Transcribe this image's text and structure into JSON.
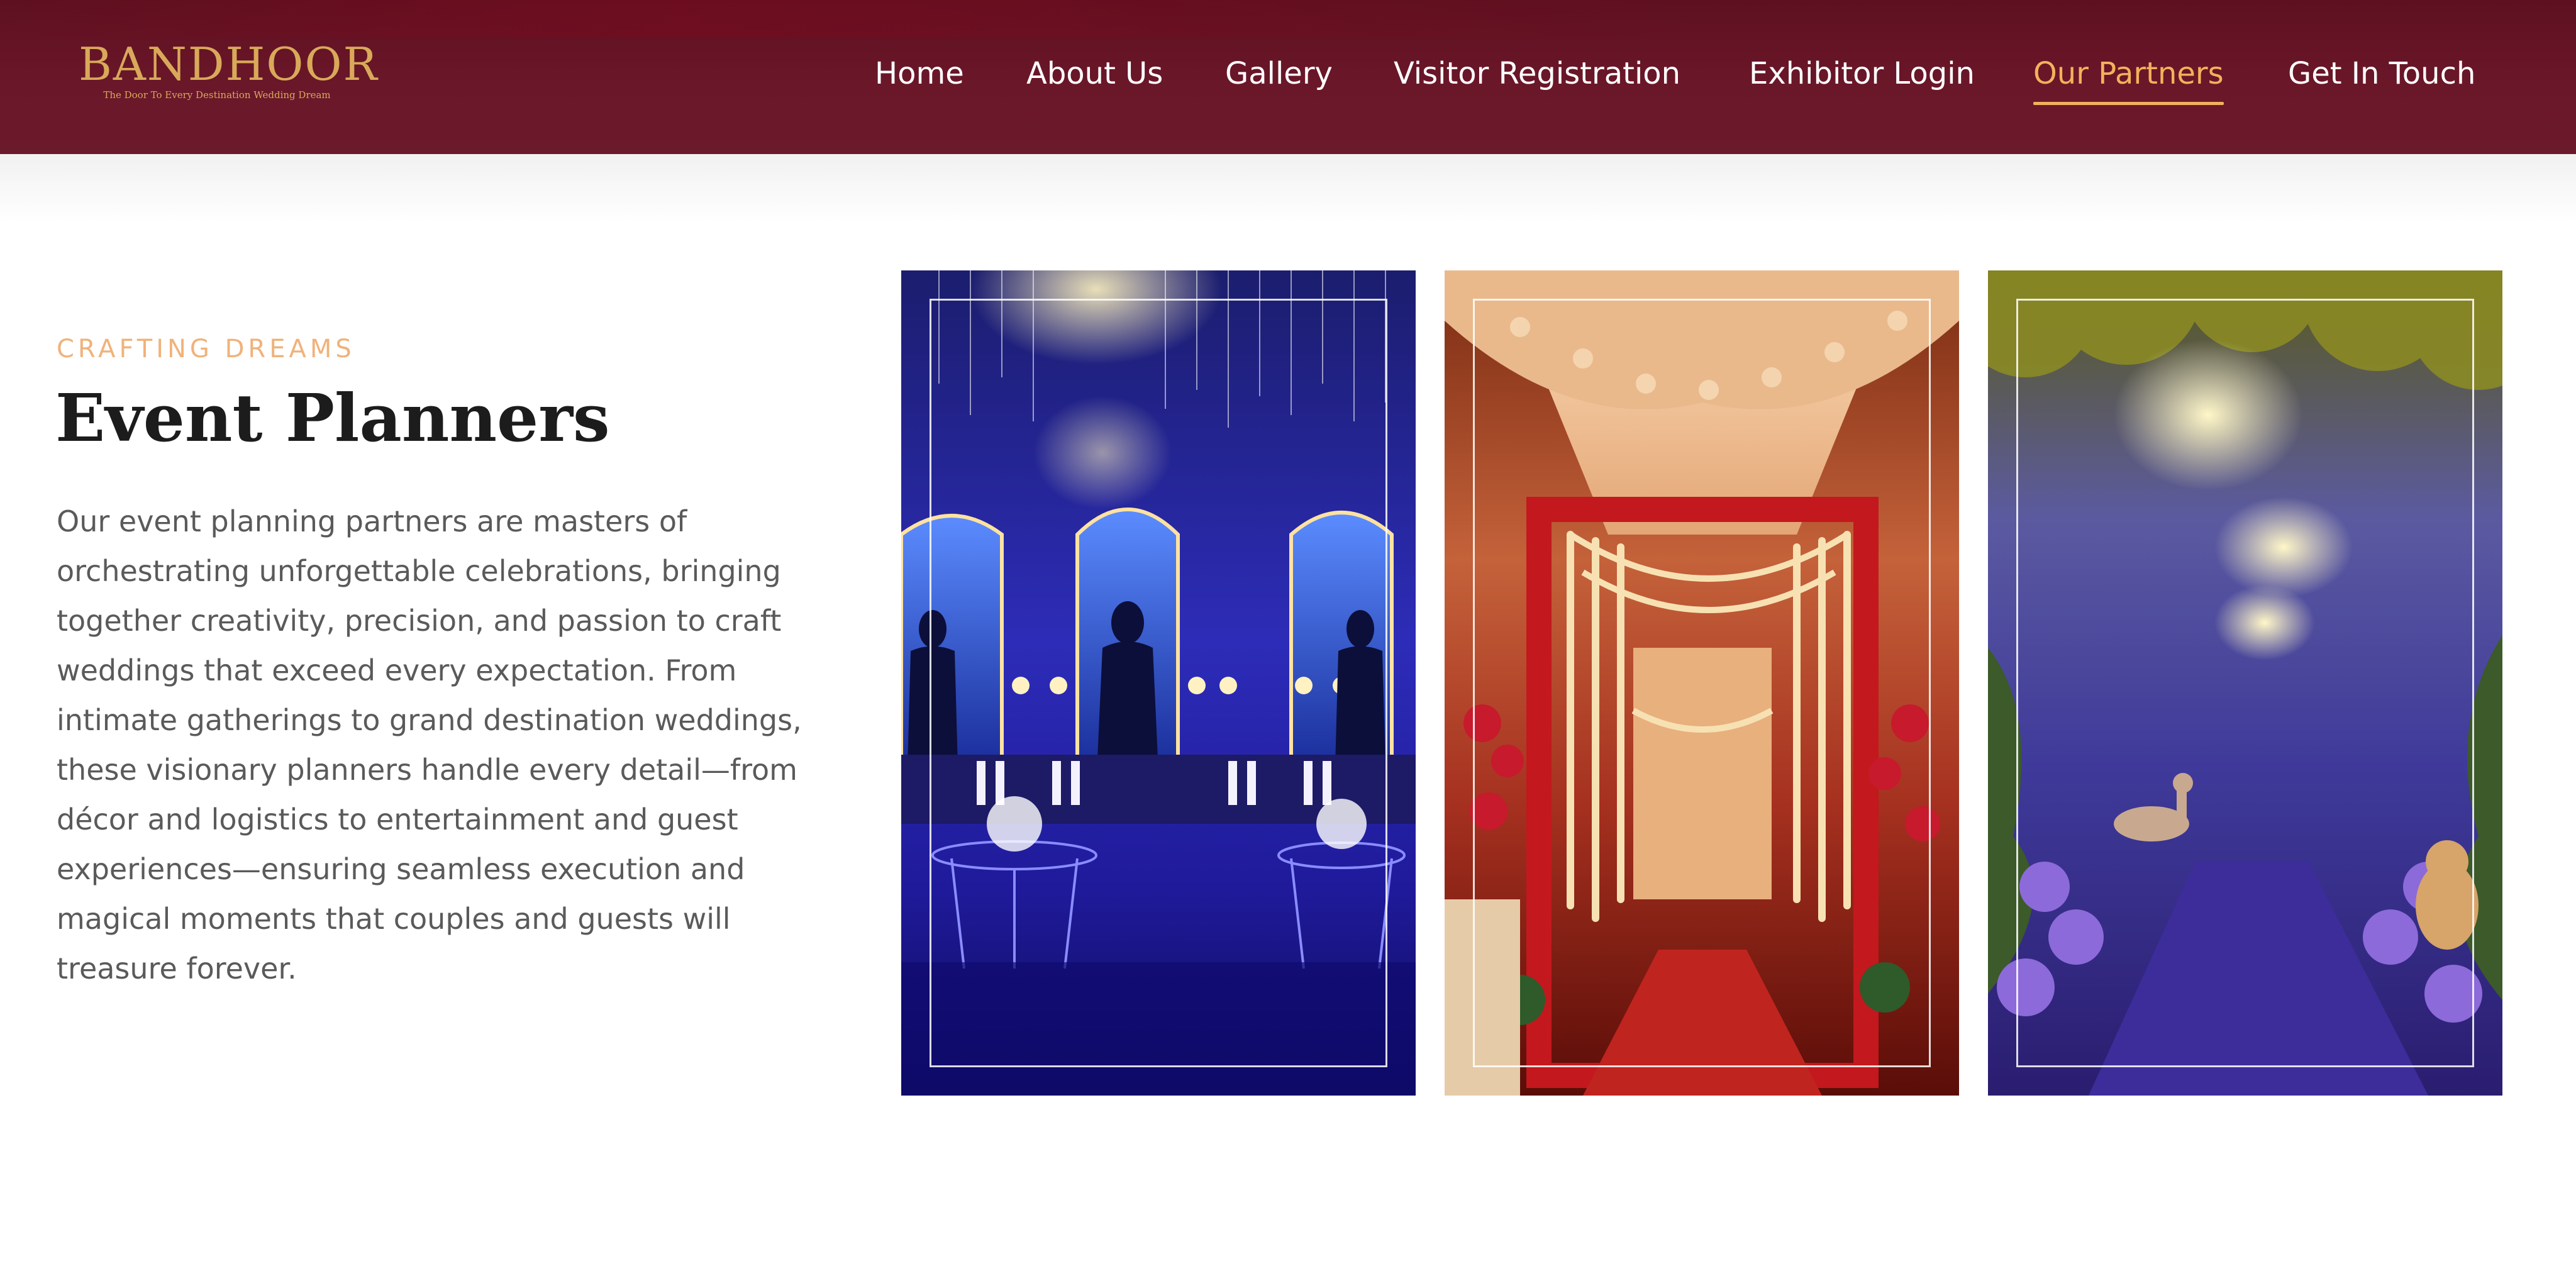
{
  "brand": {
    "name": "BANDHOOR",
    "tagline": "The Door To Every Destination Wedding Dream",
    "color": "#d9a95a"
  },
  "nav": {
    "items": [
      {
        "label": "Home",
        "active": false
      },
      {
        "label": "About Us",
        "active": false
      },
      {
        "label": "Gallery",
        "active": false
      },
      {
        "label": "Visitor Registration",
        "active": false
      },
      {
        "label": "Exhibitor Login",
        "active": false
      },
      {
        "label": "Our Partners",
        "active": true
      },
      {
        "label": "Get In Touch",
        "active": false
      }
    ],
    "active_color": "#f2b25c"
  },
  "section": {
    "eyebrow": "CRAFTING DREAMS",
    "title": "Event Planners",
    "body": "Our event planning partners are masters of orchestrating unforgettable celebrations, bringing together creativity, precision, and passion to craft weddings that exceed every expectation. From intimate gatherings to grand destination weddings, these visionary planners handle every detail—from décor and logistics to entertainment and guest experiences—ensuring seamless execution and magical moments that couples and guests will treasure forever."
  },
  "gallery": [
    {
      "name": "photo-blue-arches",
      "theme": "blue"
    },
    {
      "name": "photo-marigold-corridor",
      "theme": "red"
    },
    {
      "name": "photo-floral-forest-walkway",
      "theme": "purple"
    }
  ]
}
